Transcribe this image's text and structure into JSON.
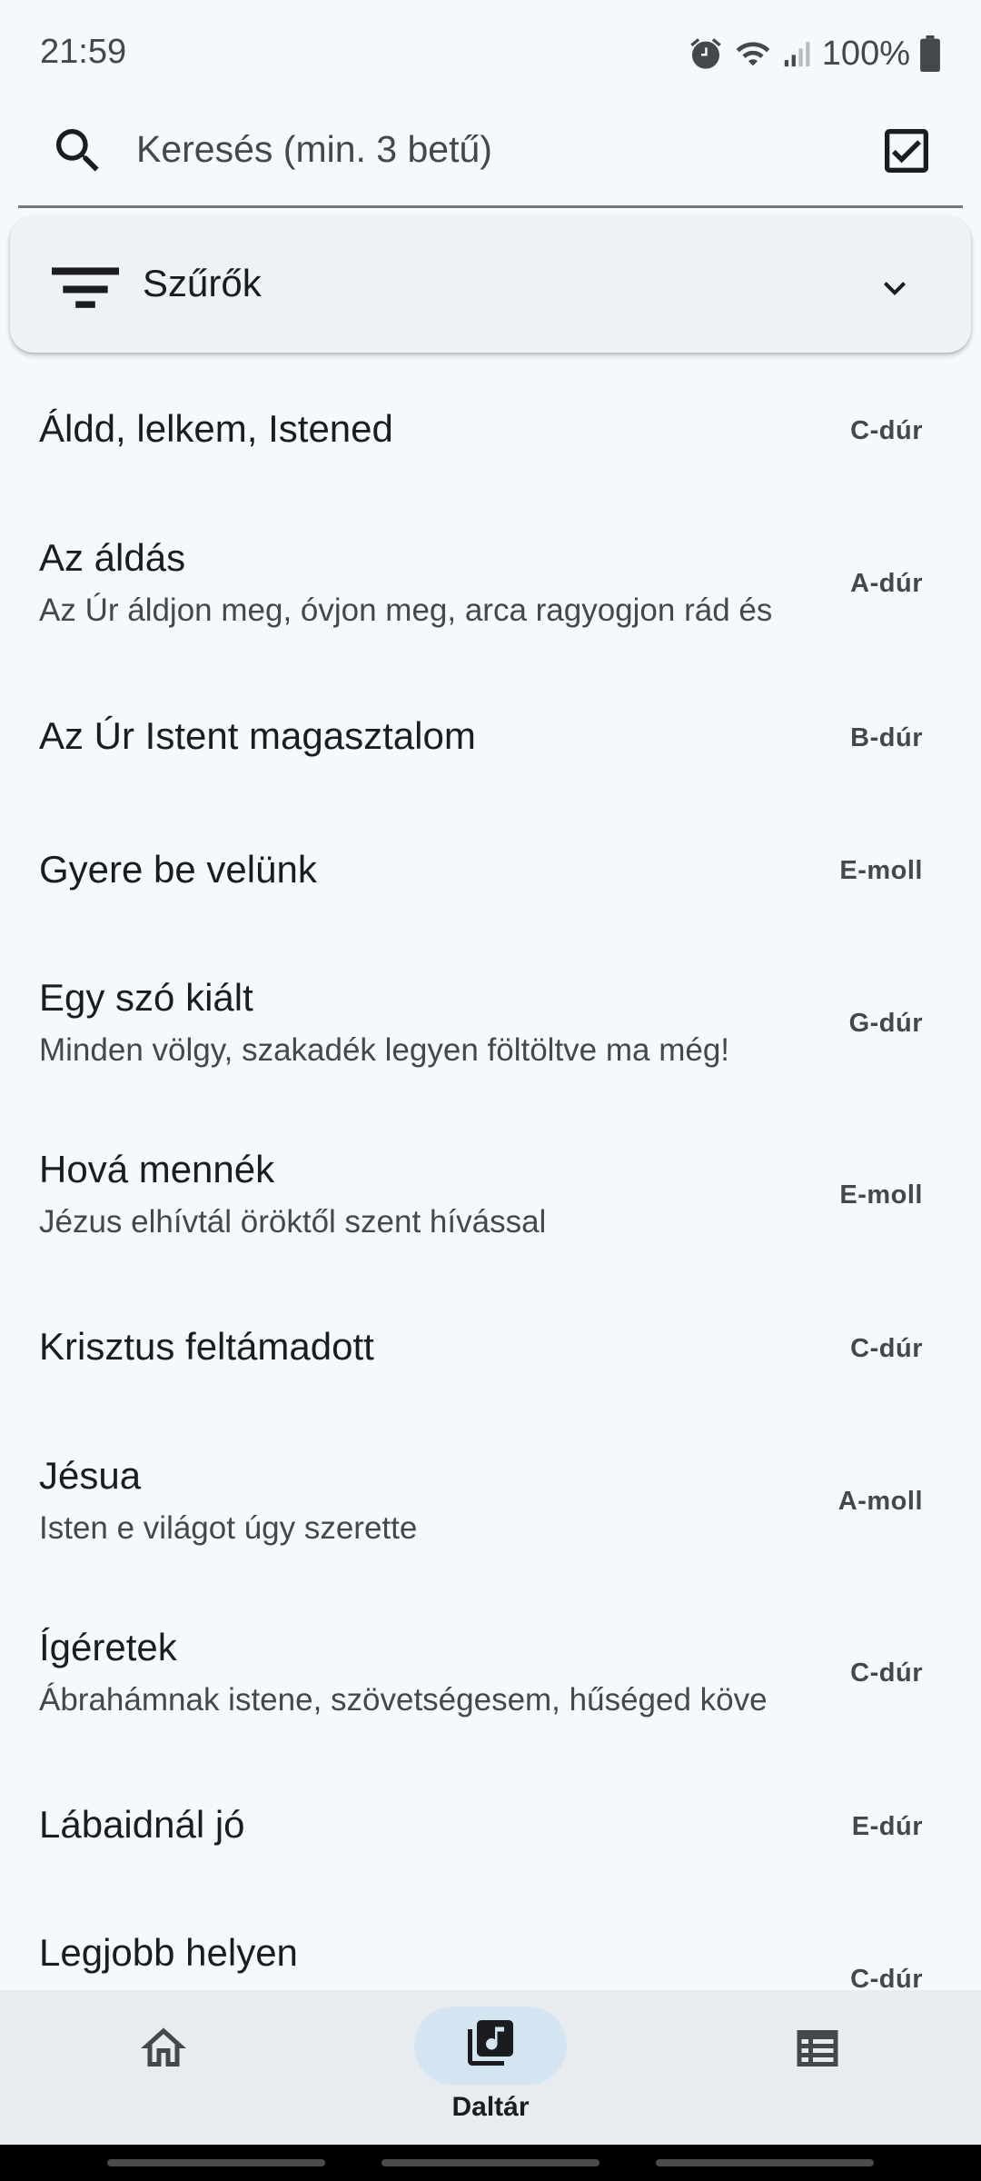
{
  "status_bar": {
    "time": "21:59",
    "battery": "100%"
  },
  "search": {
    "placeholder": "Keresés (min. 3 betű)",
    "value": ""
  },
  "filter": {
    "label": "Szűrők"
  },
  "songs": [
    {
      "title": "Áldd, lelkem, Istened",
      "subtitle": "",
      "key": "C-dúr"
    },
    {
      "title": "Az áldás",
      "subtitle": "Az Úr áldjon meg, óvjon meg, arca ragyogjon rád és",
      "key": "A-dúr"
    },
    {
      "title": "Az Úr Istent magasztalom",
      "subtitle": "",
      "key": "B-dúr"
    },
    {
      "title": "Gyere be velünk",
      "subtitle": "",
      "key": "E-moll"
    },
    {
      "title": "Egy szó kiált",
      "subtitle": "Minden völgy, szakadék legyen föltöltve ma még!",
      "key": "G-dúr"
    },
    {
      "title": "Hová mennék",
      "subtitle": "Jézus elhívtál öröktől szent hívással",
      "key": "E-moll"
    },
    {
      "title": "Krisztus feltámadott",
      "subtitle": "",
      "key": "C-dúr"
    },
    {
      "title": "Jésua",
      "subtitle": "Isten e világot úgy szerette",
      "key": "A-moll"
    },
    {
      "title": "Ígéretek",
      "subtitle": "Ábrahámnak istene, szövetségesem, hűséged köve",
      "key": "C-dúr"
    },
    {
      "title": "Lábaidnál jó",
      "subtitle": "",
      "key": "E-dúr"
    },
    {
      "title": "Legjobb helyen",
      "subtitle": "",
      "key": "C-dúr"
    }
  ],
  "bottom_nav": {
    "items": [
      {
        "icon": "home-icon",
        "label": "",
        "selected": false
      },
      {
        "icon": "music-library-icon",
        "label": "Daltár",
        "selected": true
      },
      {
        "icon": "list-icon",
        "label": "",
        "selected": false
      }
    ]
  },
  "colors": {
    "background": "#f6f9fc",
    "nav_background": "#e8ebf0",
    "selected_pill": "#d3e5f1",
    "text": "#1b1c1f",
    "secondary_text": "#44474c"
  }
}
